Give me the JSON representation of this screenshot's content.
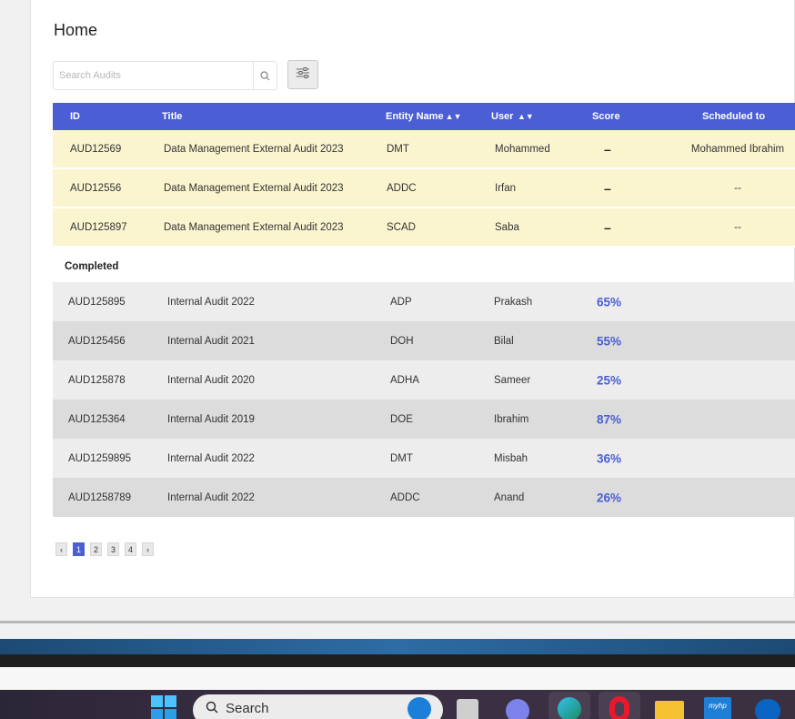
{
  "page": {
    "title": "Home"
  },
  "search": {
    "placeholder": "Search Audits"
  },
  "table": {
    "headers": {
      "id": "ID",
      "title": "Title",
      "entity": "Entity Name",
      "user": "User",
      "score": "Score",
      "scheduled": "Scheduled to"
    },
    "pending": [
      {
        "id": "AUD12569",
        "title": "Data Management External Audit 2023",
        "entity": "DMT",
        "user": "Mohammed",
        "score": "–",
        "scheduled": "Mohammed Ibrahim"
      },
      {
        "id": "AUD12556",
        "title": "Data Management External Audit 2023",
        "entity": "ADDC",
        "user": "Irfan",
        "score": "–",
        "scheduled": "--"
      },
      {
        "id": "AUD125897",
        "title": "Data Management External Audit 2023",
        "entity": "SCAD",
        "user": "Saba",
        "score": "–",
        "scheduled": "--"
      }
    ],
    "completed_label": "Completed",
    "completed": [
      {
        "id": "AUD125895",
        "title": "Internal Audit 2022",
        "entity": "ADP",
        "user": "Prakash",
        "score": "65%"
      },
      {
        "id": "AUD125456",
        "title": "Internal Audit 2021",
        "entity": "DOH",
        "user": "Bilal",
        "score": "55%"
      },
      {
        "id": "AUD125878",
        "title": "Internal Audit 2020",
        "entity": "ADHA",
        "user": "Sameer",
        "score": "25%"
      },
      {
        "id": "AUD125364",
        "title": "Internal Audit 2019",
        "entity": "DOE",
        "user": "Ibrahim",
        "score": "87%"
      },
      {
        "id": "AUD1259895",
        "title": "Internal Audit 2022",
        "entity": "DMT",
        "user": "Misbah",
        "score": "36%"
      },
      {
        "id": "AUD1258789",
        "title": "Internal Audit 2022",
        "entity": "ADDC",
        "user": "Anand",
        "score": "26%"
      }
    ]
  },
  "pagination": {
    "prev": "‹",
    "pages": [
      "1",
      "2",
      "3",
      "4"
    ],
    "current": "1",
    "next": "›"
  },
  "taskbar": {
    "search_label": "Search",
    "icons": [
      "windows-start-icon",
      "search-icon",
      "bing-icon",
      "task-view-icon",
      "chat-icon",
      "edge-icon",
      "opera-icon",
      "file-explorer-icon",
      "myhp-icon",
      "mail-icon"
    ],
    "myhp_label": "myhp"
  },
  "colors": {
    "accent": "#4b5ed3",
    "pending_row": "#fbf5cf",
    "completed_row": "#ededed"
  }
}
